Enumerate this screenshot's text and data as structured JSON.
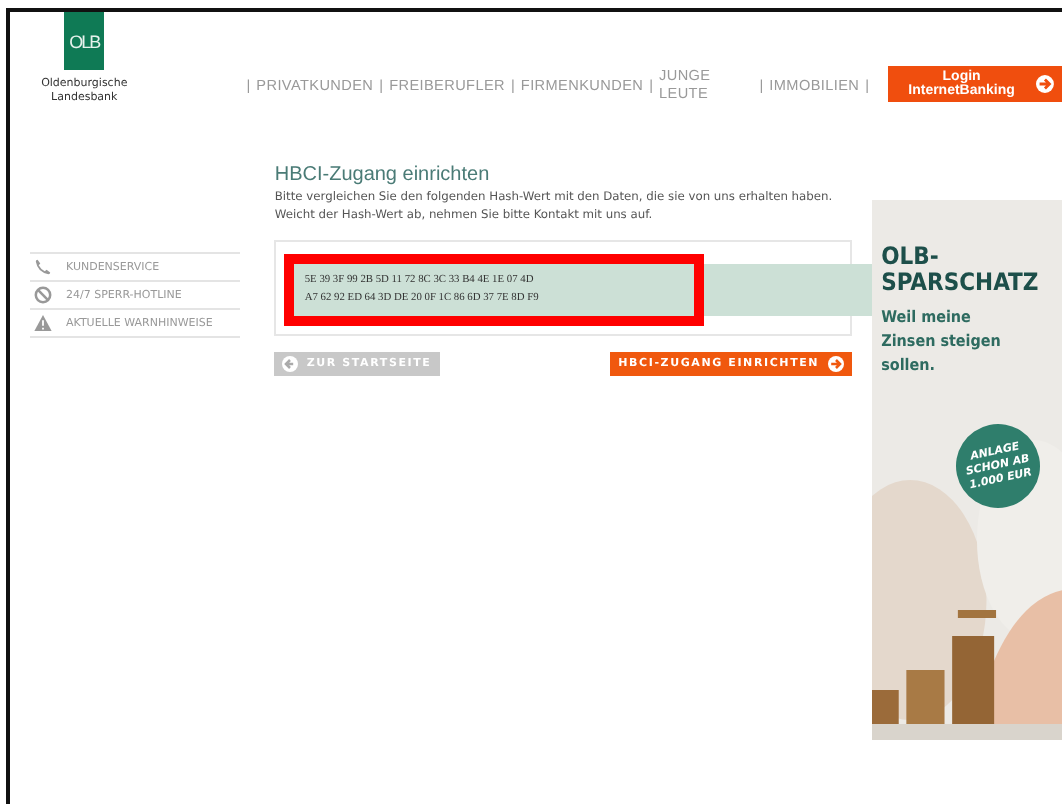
{
  "logo": {
    "mark": "OLB",
    "name_lines": [
      "Oldenburgische",
      "Landesbank"
    ]
  },
  "nav": {
    "items": [
      "PRIVATKUNDEN",
      "FREIBERUFLER",
      "FIRMENKUNDEN",
      "JUNGE LEUTE",
      "IMMOBILIEN"
    ],
    "separator": "|",
    "login": "Login InternetBanking"
  },
  "sidebar": {
    "items": [
      {
        "kind": "phone",
        "label": "KUNDENSERVICE"
      },
      {
        "kind": "block",
        "label": "24/7 SPERR-HOTLINE"
      },
      {
        "kind": "warning",
        "label": "AKTUELLE WARNHINWEISE"
      }
    ]
  },
  "content": {
    "title": "HBCI-Zugang einrichten",
    "text": "Bitte vergleichen Sie den folgenden Hash-Wert mit den Daten, die sie von uns erhalten haben. Weicht der Hash-Wert ab, nehmen Sie bitte Kontakt mit uns auf.",
    "hash_lines": [
      "5E 39 3F 99 2B 5D 11 72 8C 3C 33 B4 4E 1E 07 4D",
      "A7 62 92 ED 64 3D DE 20 0F 1C 86 6D 37 7E 8D F9"
    ],
    "back_button": "ZUR STARTSEITE",
    "submit_button": "HBCI-ZUGANG EINRICHTEN"
  },
  "ad": {
    "kind": "picture",
    "title_lines": [
      "OLB-",
      "SPARSCHATZ"
    ],
    "subtitle_lines": [
      "Weil meine",
      "Zinsen steigen",
      "sollen."
    ],
    "badge_lines": [
      "ANLAGE",
      "SCHON AB",
      "1.000 EUR"
    ]
  }
}
